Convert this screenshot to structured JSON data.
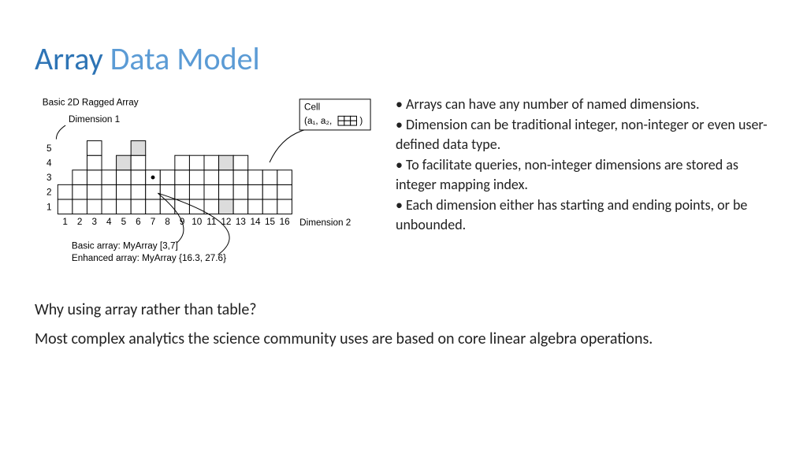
{
  "title": {
    "em": "Array",
    "rest": " Data Model"
  },
  "bullets": [
    "Arrays can have any number of named dimensions.",
    "Dimension can be traditional integer, non-integer or even user-defined data type.",
    "To facilitate queries, non-integer dimensions are stored as integer mapping index.",
    "Each dimension either has starting and ending points, or be unbounded."
  ],
  "question": "Why using array rather than table?",
  "answer": "Most complex analytics the science community uses are based on core linear algebra operations.",
  "diagram": {
    "header": "Basic 2D Ragged Array",
    "dim1_label": "Dimension 1",
    "dim2_label": "Dimension 2",
    "y_ticks": [
      "1",
      "2",
      "3",
      "4",
      "5"
    ],
    "x_ticks": [
      "1",
      "2",
      "3",
      "4",
      "5",
      "6",
      "7",
      "8",
      "9",
      "10",
      "11",
      "12",
      "13",
      "14",
      "15",
      "16"
    ],
    "legend": {
      "title": "Cell",
      "coords": "(a₁, a₂,",
      "tail": ")"
    },
    "footer1": "Basic array: MyArray [3,7]",
    "footer2": "Enhanced array: MyArray {16.3, 27.6}",
    "ragged_columns": {
      "1": {
        "y0": 1,
        "y1": 2
      },
      "2": {
        "y0": 1,
        "y1": 3
      },
      "3": {
        "y0": 1,
        "y1": 5
      },
      "4": {
        "y0": 1,
        "y1": 3
      },
      "5": {
        "y0": 1,
        "y1": 4
      },
      "6": {
        "y0": 1,
        "y1": 5
      },
      "7": {
        "y0": 1,
        "y1": 3
      },
      "8": {
        "y0": 1,
        "y1": 3
      },
      "9": {
        "y0": 1,
        "y1": 4
      },
      "10": {
        "y0": 1,
        "y1": 4
      },
      "11": {
        "y0": 1,
        "y1": 4
      },
      "12": {
        "y0": 1,
        "y1": 4
      },
      "13": {
        "y0": 1,
        "y1": 4
      },
      "14": {
        "y0": 1,
        "y1": 3
      },
      "15": {
        "y0": 1,
        "y1": 3
      },
      "16": {
        "y0": 1,
        "y1": 3
      }
    },
    "shaded_cells": [
      [
        5,
        4
      ],
      [
        6,
        5
      ],
      [
        12,
        4
      ],
      [
        12,
        1
      ]
    ],
    "pointer_cell": [
      7,
      3
    ]
  }
}
